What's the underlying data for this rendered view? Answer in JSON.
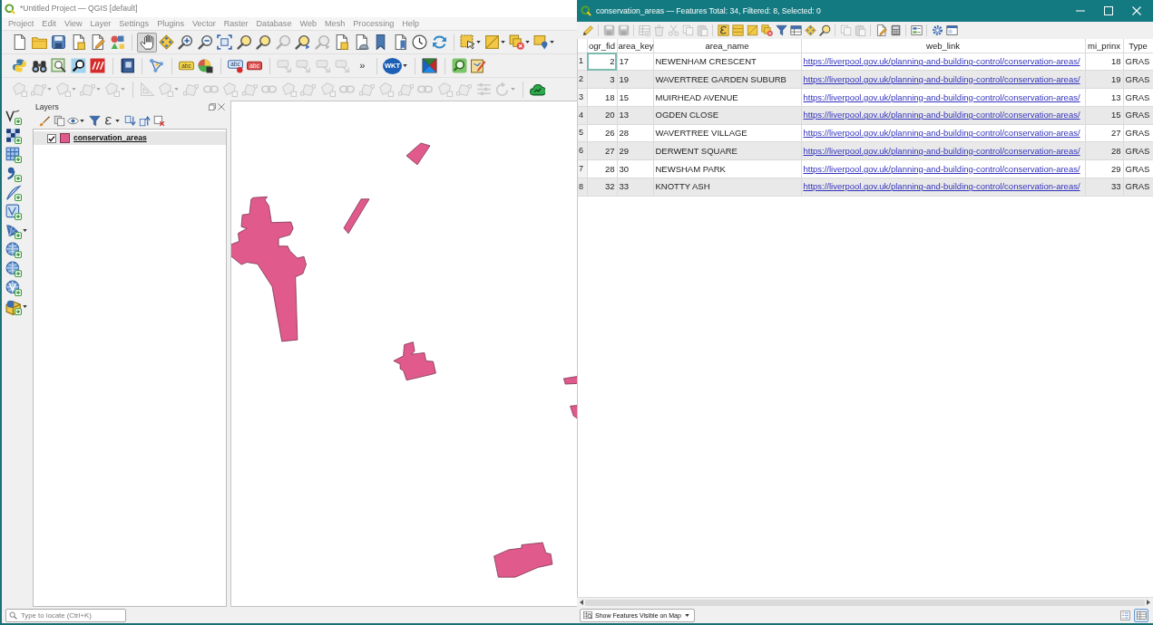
{
  "main_window": {
    "title": "*Untitled Project — QGIS [default]",
    "active": false,
    "menu": [
      "Project",
      "Edit",
      "View",
      "Layer",
      "Settings",
      "Plugins",
      "Vector",
      "Raster",
      "Database",
      "Web",
      "Mesh",
      "Processing",
      "Help"
    ],
    "toolbars": [
      {
        "groups": [
          [
            {
              "kind": "page",
              "disabled": false,
              "selected": false,
              "menu": false
            },
            {
              "kind": "folder",
              "disabled": false,
              "selected": false,
              "menu": false
            },
            {
              "kind": "disk",
              "disabled": false,
              "selected": false,
              "menu": false
            },
            {
              "kind": "page-square",
              "disabled": false,
              "selected": false,
              "menu": false
            },
            {
              "kind": "page-pen",
              "disabled": false,
              "selected": false,
              "menu": false
            },
            {
              "kind": "shapes",
              "disabled": false,
              "selected": false,
              "menu": false
            }
          ],
          [
            {
              "kind": "hand",
              "disabled": false,
              "selected": true,
              "menu": false
            },
            {
              "kind": "diamond",
              "disabled": false,
              "selected": false,
              "menu": false
            },
            {
              "kind": "zoom-in",
              "disabled": false,
              "selected": false,
              "menu": false
            },
            {
              "kind": "zoom-out",
              "disabled": false,
              "selected": false,
              "menu": false
            },
            {
              "kind": "expand",
              "disabled": false,
              "selected": false,
              "menu": false
            },
            {
              "kind": "magnifier",
              "disabled": false,
              "selected": false,
              "menu": false
            },
            {
              "kind": "magnifier",
              "disabled": false,
              "selected": false,
              "menu": false
            },
            {
              "kind": "magnifier",
              "disabled": true,
              "selected": false,
              "menu": false
            },
            {
              "kind": "magnifier-arrow",
              "disabled": false,
              "selected": false,
              "menu": false
            },
            {
              "kind": "magnifier-arrow",
              "disabled": true,
              "selected": false,
              "menu": false
            },
            {
              "kind": "page-square",
              "disabled": false,
              "selected": false,
              "menu": false
            },
            {
              "kind": "dome",
              "disabled": false,
              "selected": false,
              "menu": false
            },
            {
              "kind": "bookmark",
              "disabled": false,
              "selected": false,
              "menu": false
            },
            {
              "kind": "bookmarks",
              "disabled": false,
              "selected": false,
              "menu": false
            },
            {
              "kind": "clock",
              "disabled": false,
              "selected": false,
              "menu": false
            },
            {
              "kind": "refresh",
              "disabled": false,
              "selected": false,
              "menu": false
            }
          ],
          [
            {
              "kind": "select",
              "disabled": false,
              "selected": false,
              "menu": true
            },
            {
              "kind": "square",
              "disabled": false,
              "selected": false,
              "menu": true
            },
            {
              "kind": "square-x",
              "disabled": false,
              "selected": false,
              "menu": true
            },
            {
              "kind": "square-pin",
              "disabled": false,
              "selected": false,
              "menu": true
            }
          ]
        ]
      },
      {
        "groups": [
          [
            {
              "kind": "snake",
              "disabled": false,
              "selected": false,
              "menu": false
            },
            {
              "kind": "binoculars",
              "disabled": false,
              "selected": false,
              "menu": false
            },
            {
              "kind": "map-magnifier",
              "disabled": false,
              "selected": false,
              "menu": false
            },
            {
              "kind": "magnifier-tile",
              "disabled": false,
              "selected": false,
              "menu": false
            },
            {
              "kind": "slash-tile",
              "disabled": false,
              "selected": false,
              "menu": false
            }
          ],
          [
            {
              "kind": "book",
              "disabled": false,
              "selected": false,
              "menu": false
            }
          ],
          [
            {
              "kind": "network",
              "disabled": false,
              "selected": false,
              "menu": false
            }
          ],
          [
            {
              "kind": "tag",
              "text": "abc",
              "disabled": false,
              "selected": false,
              "menu": false
            },
            {
              "kind": "pie",
              "disabled": false,
              "selected": false,
              "menu": false
            }
          ],
          [
            {
              "kind": "tag-dot",
              "text": "abc",
              "disabled": false,
              "selected": false,
              "menu": false
            },
            {
              "kind": "tag-red",
              "text": "abc",
              "disabled": false,
              "selected": false,
              "menu": false
            }
          ],
          [
            {
              "kind": "tag-arrow",
              "disabled": true,
              "selected": false,
              "menu": false
            },
            {
              "kind": "tag-arrow",
              "disabled": true,
              "selected": false,
              "menu": false
            },
            {
              "kind": "tag-arrow",
              "disabled": true,
              "selected": false,
              "menu": false
            },
            {
              "kind": "tag-arrow",
              "disabled": true,
              "selected": false,
              "menu": false
            },
            {
              "kind": "chevron",
              "text": "»",
              "disabled": false,
              "selected": false,
              "menu": false
            }
          ],
          [
            {
              "kind": "wkt",
              "text": "WKT",
              "disabled": false,
              "selected": false,
              "menu": true
            }
          ],
          [
            {
              "kind": "triangles",
              "disabled": false,
              "selected": false,
              "menu": false
            }
          ],
          [
            {
              "kind": "magnifier-green",
              "disabled": false,
              "selected": false,
              "menu": false
            },
            {
              "kind": "map-pencil",
              "disabled": false,
              "selected": false,
              "menu": false
            }
          ]
        ]
      },
      {
        "groups": [
          [
            {
              "kind": "poly",
              "disabled": true,
              "selected": false,
              "menu": false
            },
            {
              "kind": "poly-node",
              "disabled": true,
              "selected": false,
              "menu": true
            },
            {
              "kind": "poly",
              "disabled": true,
              "selected": false,
              "menu": true
            },
            {
              "kind": "poly-node",
              "disabled": true,
              "selected": false,
              "menu": true
            },
            {
              "kind": "poly",
              "disabled": true,
              "selected": false,
              "menu": true
            }
          ],
          [
            {
              "kind": "angle",
              "disabled": true,
              "selected": false,
              "menu": false
            },
            {
              "kind": "poly",
              "disabled": true,
              "selected": false,
              "menu": true
            },
            {
              "kind": "poly-node",
              "disabled": true,
              "selected": false,
              "menu": false
            },
            {
              "kind": "link",
              "disabled": true,
              "selected": false,
              "menu": false
            },
            {
              "kind": "poly",
              "disabled": true,
              "selected": false,
              "menu": false
            },
            {
              "kind": "poly-node",
              "disabled": true,
              "selected": false,
              "menu": false
            },
            {
              "kind": "link",
              "disabled": true,
              "selected": false,
              "menu": false
            },
            {
              "kind": "poly",
              "disabled": true,
              "selected": false,
              "menu": false
            },
            {
              "kind": "poly-node",
              "disabled": true,
              "selected": false,
              "menu": false
            },
            {
              "kind": "poly",
              "disabled": true,
              "selected": false,
              "menu": false
            },
            {
              "kind": "link",
              "disabled": true,
              "selected": false,
              "menu": false
            },
            {
              "kind": "poly-node",
              "disabled": true,
              "selected": false,
              "menu": false
            },
            {
              "kind": "poly",
              "disabled": true,
              "selected": false,
              "menu": false
            },
            {
              "kind": "poly-node",
              "disabled": true,
              "selected": false,
              "menu": false
            },
            {
              "kind": "link",
              "disabled": true,
              "selected": false,
              "menu": false
            },
            {
              "kind": "poly",
              "disabled": true,
              "selected": false,
              "menu": false
            },
            {
              "kind": "poly-node",
              "disabled": true,
              "selected": false,
              "menu": false
            },
            {
              "kind": "lines",
              "disabled": true,
              "selected": false,
              "menu": false
            },
            {
              "kind": "rotate",
              "disabled": true,
              "selected": false,
              "menu": true
            }
          ],
          [
            {
              "kind": "cloud",
              "disabled": false,
              "selected": false,
              "menu": false
            }
          ]
        ]
      }
    ],
    "side_toolbar": [
      {
        "kind": "v-plus",
        "menu": false
      },
      {
        "kind": "checker-plus",
        "menu": false
      },
      {
        "kind": "grid-plus",
        "menu": false
      },
      {
        "kind": "curve-plus",
        "menu": false
      },
      {
        "kind": "feather-plus",
        "menu": false
      },
      {
        "kind": "frame-plus",
        "menu": false
      },
      {
        "kind": "mesh-plus",
        "menu": true
      },
      {
        "kind": "globe-plus",
        "menu": false
      },
      {
        "kind": "globe-plus",
        "menu": false
      },
      {
        "kind": "globe-v-plus",
        "menu": false
      },
      {
        "kind": "cube-plus",
        "menu": true
      }
    ],
    "layers_panel": {
      "title": "Layers",
      "toolbar": [
        {
          "kind": "brush",
          "menu": false
        },
        {
          "kind": "pages",
          "menu": false
        },
        {
          "kind": "eye",
          "menu": true
        },
        {
          "kind": "filter",
          "menu": false
        },
        {
          "kind": "epsilon",
          "menu": true
        },
        {
          "kind": "down-arrow",
          "menu": false
        },
        {
          "kind": "up-arrow",
          "menu": false
        },
        {
          "kind": "remove",
          "menu": false
        }
      ],
      "layers": [
        {
          "name": "conservation_areas",
          "checked": true,
          "selected": true,
          "color": "#e05a8b"
        }
      ]
    },
    "locator": {
      "placeholder": "Type to locate (Ctrl+K)"
    }
  },
  "attribute_table": {
    "title": "conservation_areas — Features Total: 34, Filtered: 8, Selected: 0",
    "active": true,
    "toolbar": {
      "groups": [
        [
          {
            "kind": "pencil",
            "disabled": false
          }
        ],
        [
          {
            "kind": "disk",
            "disabled": true
          },
          {
            "kind": "disk",
            "disabled": true
          }
        ],
        [
          {
            "kind": "table-plus",
            "disabled": true
          },
          {
            "kind": "trash",
            "disabled": true
          },
          {
            "kind": "scissors",
            "disabled": true
          },
          {
            "kind": "copy",
            "disabled": true
          },
          {
            "kind": "clipboard",
            "disabled": true
          }
        ],
        [
          {
            "kind": "epsilon-square",
            "disabled": false
          },
          {
            "kind": "rows",
            "disabled": false
          },
          {
            "kind": "square",
            "disabled": false
          },
          {
            "kind": "square-x",
            "disabled": false
          },
          {
            "kind": "filter",
            "disabled": false
          },
          {
            "kind": "table-top",
            "disabled": false
          },
          {
            "kind": "diamond",
            "disabled": false
          },
          {
            "kind": "magnifier",
            "disabled": false
          }
        ],
        [
          {
            "kind": "copy",
            "disabled": true
          },
          {
            "kind": "clipboard",
            "disabled": true
          }
        ],
        [
          {
            "kind": "page-pen",
            "disabled": false
          },
          {
            "kind": "calculator",
            "disabled": false
          }
        ],
        [
          {
            "kind": "format-list",
            "disabled": false
          }
        ],
        [
          {
            "kind": "gear",
            "disabled": false
          },
          {
            "kind": "window",
            "disabled": false
          }
        ]
      ]
    },
    "columns": [
      {
        "title": "ogr_fid",
        "kind": "number"
      },
      {
        "title": "area_key",
        "kind": "text"
      },
      {
        "title": "area_name",
        "kind": "text"
      },
      {
        "title": "web_link",
        "kind": "link"
      },
      {
        "title": "mi_prinx",
        "kind": "number"
      },
      {
        "title": "Type",
        "kind": "text"
      }
    ],
    "rows": [
      {
        "number": "1",
        "focused": true,
        "cells": [
          "2",
          "17",
          "NEWENHAM CRESCENT",
          "https://liverpool.gov.uk/planning-and-building-control/conservation-areas/",
          "18",
          "GRAS"
        ]
      },
      {
        "number": "2",
        "focused": false,
        "cells": [
          "3",
          "19",
          "WAVERTREE GARDEN SUBURB",
          "https://liverpool.gov.uk/planning-and-building-control/conservation-areas/",
          "19",
          "GRAS"
        ]
      },
      {
        "number": "3",
        "focused": false,
        "cells": [
          "18",
          "15",
          "MUIRHEAD AVENUE",
          "https://liverpool.gov.uk/planning-and-building-control/conservation-areas/",
          "13",
          "GRAS"
        ]
      },
      {
        "number": "4",
        "focused": false,
        "cells": [
          "20",
          "13",
          "OGDEN CLOSE",
          "https://liverpool.gov.uk/planning-and-building-control/conservation-areas/",
          "15",
          "GRAS"
        ]
      },
      {
        "number": "5",
        "focused": false,
        "cells": [
          "26",
          "28",
          "WAVERTREE VILLAGE",
          "https://liverpool.gov.uk/planning-and-building-control/conservation-areas/",
          "27",
          "GRAS"
        ]
      },
      {
        "number": "6",
        "focused": false,
        "cells": [
          "27",
          "29",
          "DERWENT SQUARE",
          "https://liverpool.gov.uk/planning-and-building-control/conservation-areas/",
          "28",
          "GRAS"
        ]
      },
      {
        "number": "7",
        "focused": false,
        "cells": [
          "28",
          "30",
          "NEWSHAM PARK",
          "https://liverpool.gov.uk/planning-and-building-control/conservation-areas/",
          "29",
          "GRAS"
        ]
      },
      {
        "number": "8",
        "focused": false,
        "cells": [
          "32",
          "33",
          "KNOTTY ASH",
          "https://liverpool.gov.uk/planning-and-building-control/conservation-areas/",
          "33",
          "GRAS"
        ]
      }
    ],
    "filter_button": {
      "label": "Show Features Visible on Map"
    },
    "view_modes": [
      {
        "kind": "form",
        "selected": false
      },
      {
        "kind": "grid",
        "selected": true
      }
    ]
  }
}
